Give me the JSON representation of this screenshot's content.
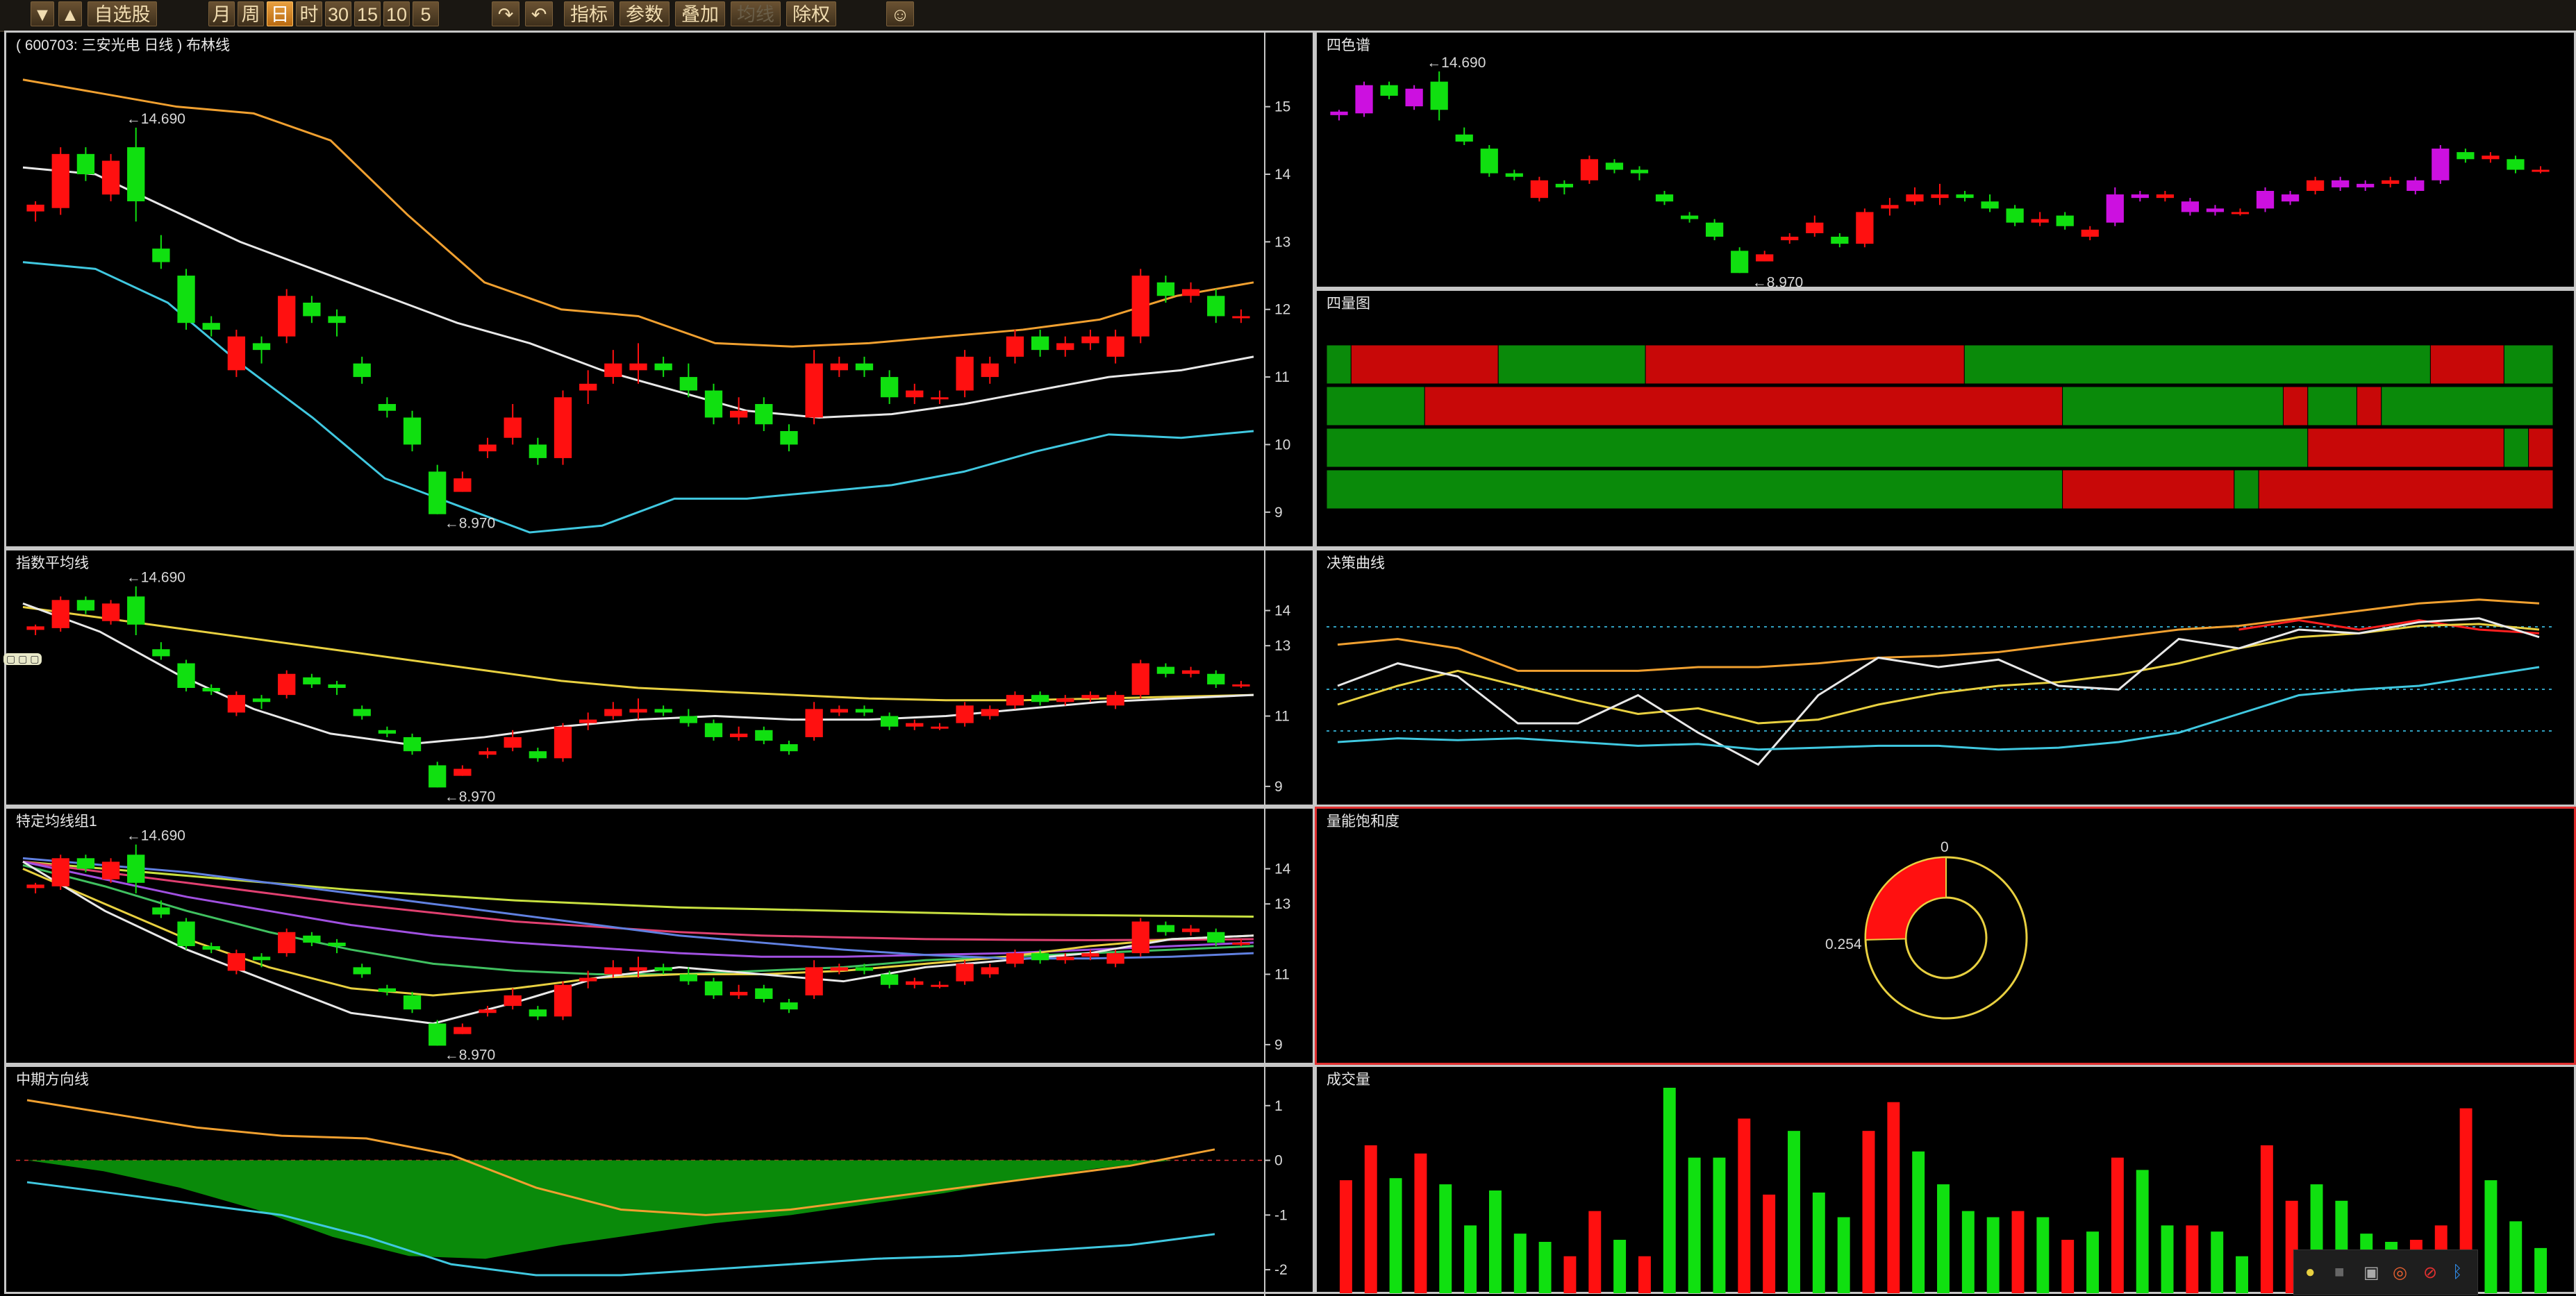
{
  "toolbar": {
    "down_arrow": "▼",
    "up_arrow": "▲",
    "watchlist": "自选股",
    "periods": [
      "月",
      "周",
      "日",
      "时",
      "30",
      "15",
      "10",
      "5"
    ],
    "active_period": "日",
    "back_icon": "back-arrow-icon",
    "undo_icon": "undo-arrow-icon",
    "indicator": "指标",
    "params": "参数",
    "overlay": "叠加",
    "ma": "均线",
    "exright": "除权",
    "face_icon": "avatar-face-icon"
  },
  "colors": {
    "up": "#ff1010",
    "down": "#10e010",
    "bg": "#000000",
    "panel_border": "#c7c7c7",
    "active_border": "#e03030",
    "purple": "#cc10e0",
    "green_fill": "#0a8a0a",
    "orange": "#f0a030",
    "white": "#e8e8e8",
    "cyan": "#40c8e0",
    "yellow": "#e8d040"
  },
  "panels": {
    "bollinger": {
      "title": "( 600703: 三安光电 日线 ) 布林线",
      "axis_labels": [
        "15",
        "14",
        "13",
        "12",
        "11",
        "10",
        "9"
      ],
      "high_label": "←14.690",
      "low_label": "←8.970"
    },
    "ema": {
      "title": "指数平均线",
      "axis_labels": [
        "14",
        "13",
        "11",
        "9"
      ],
      "high_label": "←14.690",
      "low_label": "←8.970",
      "tag": "▢ ▢ ▢"
    },
    "special_ma": {
      "title": "特定均线组1",
      "axis_labels": [
        "14",
        "13",
        "11",
        "9"
      ],
      "high_label": "←14.690",
      "low_label": "←8.970"
    },
    "mid_direction": {
      "title": "中期方向线",
      "axis_labels": [
        "1",
        "0",
        "-1",
        "-2"
      ]
    },
    "four_color": {
      "title": "四色谱",
      "high_label": "←14.690",
      "low_label": "←8.970"
    },
    "four_quadrant": {
      "title": "四量图"
    },
    "decision": {
      "title": "决策曲线"
    },
    "saturation": {
      "title": "量能饱和度",
      "top_label": "0",
      "value_label": "0.254",
      "value": 0.254
    },
    "volume": {
      "title": "成交量"
    }
  },
  "chart_data": [
    {
      "type": "candlestick",
      "name": "bollinger",
      "ylim": [
        8.7,
        15.5
      ],
      "candles": [
        [
          13.45,
          13.55,
          13.3,
          13.6
        ],
        [
          13.5,
          14.3,
          13.4,
          14.4
        ],
        [
          14.3,
          14.0,
          13.9,
          14.4
        ],
        [
          13.7,
          14.2,
          13.6,
          14.3
        ],
        [
          14.4,
          13.6,
          13.3,
          14.69
        ],
        [
          12.9,
          12.7,
          12.6,
          13.1
        ],
        [
          12.5,
          11.8,
          11.7,
          12.6
        ],
        [
          11.8,
          11.7,
          11.6,
          11.9
        ],
        [
          11.1,
          11.6,
          11.0,
          11.7
        ],
        [
          11.5,
          11.4,
          11.2,
          11.6
        ],
        [
          11.6,
          12.2,
          11.5,
          12.3
        ],
        [
          12.1,
          11.9,
          11.8,
          12.2
        ],
        [
          11.9,
          11.8,
          11.6,
          12.0
        ],
        [
          11.2,
          11.0,
          10.9,
          11.3
        ],
        [
          10.6,
          10.5,
          10.4,
          10.7
        ],
        [
          10.4,
          10.0,
          9.9,
          10.5
        ],
        [
          9.6,
          8.97,
          8.97,
          9.7
        ],
        [
          9.3,
          9.5,
          9.3,
          9.6
        ],
        [
          9.9,
          10.0,
          9.8,
          10.1
        ],
        [
          10.1,
          10.4,
          10.0,
          10.6
        ],
        [
          10.0,
          9.8,
          9.7,
          10.1
        ],
        [
          9.8,
          10.7,
          9.7,
          10.8
        ],
        [
          10.8,
          10.9,
          10.6,
          11.1
        ],
        [
          11.0,
          11.2,
          10.9,
          11.4
        ],
        [
          11.1,
          11.2,
          10.9,
          11.5
        ],
        [
          11.2,
          11.1,
          11.0,
          11.3
        ],
        [
          11.0,
          10.8,
          10.7,
          11.2
        ],
        [
          10.8,
          10.4,
          10.3,
          10.9
        ],
        [
          10.4,
          10.5,
          10.3,
          10.7
        ],
        [
          10.6,
          10.3,
          10.2,
          10.7
        ],
        [
          10.2,
          10.0,
          9.9,
          10.3
        ],
        [
          10.4,
          11.2,
          10.3,
          11.4
        ],
        [
          11.1,
          11.2,
          11.0,
          11.3
        ],
        [
          11.2,
          11.1,
          11.0,
          11.3
        ],
        [
          11.0,
          10.7,
          10.6,
          11.1
        ],
        [
          10.7,
          10.8,
          10.6,
          10.9
        ],
        [
          10.7,
          10.7,
          10.6,
          10.8
        ],
        [
          10.8,
          11.3,
          10.7,
          11.4
        ],
        [
          11.0,
          11.2,
          10.9,
          11.3
        ],
        [
          11.3,
          11.6,
          11.2,
          11.7
        ],
        [
          11.6,
          11.4,
          11.3,
          11.7
        ],
        [
          11.4,
          11.5,
          11.3,
          11.6
        ],
        [
          11.5,
          11.6,
          11.4,
          11.7
        ],
        [
          11.3,
          11.6,
          11.2,
          11.7
        ],
        [
          11.6,
          12.5,
          11.5,
          12.6
        ],
        [
          12.4,
          12.2,
          12.1,
          12.5
        ],
        [
          12.2,
          12.3,
          12.1,
          12.4
        ],
        [
          12.2,
          11.9,
          11.8,
          12.3
        ],
        [
          11.9,
          11.9,
          11.8,
          12.0
        ]
      ],
      "mid": [
        14.1,
        14.0,
        13.5,
        13.0,
        12.6,
        12.2,
        11.8,
        11.5,
        11.1,
        10.8,
        10.5,
        10.4,
        10.45,
        10.6,
        10.8,
        11.0,
        11.1,
        11.3
      ],
      "upper": [
        15.4,
        15.2,
        15.0,
        14.9,
        14.5,
        13.4,
        12.4,
        12.0,
        11.9,
        11.5,
        11.45,
        11.5,
        11.6,
        11.7,
        11.85,
        12.2,
        12.4
      ],
      "lower": [
        12.7,
        12.6,
        12.1,
        11.2,
        10.4,
        9.5,
        9.1,
        8.7,
        8.8,
        9.2,
        9.2,
        9.3,
        9.4,
        9.6,
        9.9,
        10.15,
        10.1,
        10.2
      ]
    },
    {
      "type": "bar",
      "name": "volume",
      "values": [
        0.55,
        0.72,
        0.56,
        0.68,
        0.53,
        0.33,
        0.5,
        0.29,
        0.25,
        0.18,
        0.4,
        0.26,
        0.18,
        1.0,
        0.66,
        0.66,
        0.85,
        0.48,
        0.79,
        0.49,
        0.37,
        0.79,
        0.93,
        0.69,
        0.53,
        0.4,
        0.37,
        0.4,
        0.37,
        0.26,
        0.3,
        0.66,
        0.6,
        0.33,
        0.33,
        0.3,
        0.18,
        0.72,
        0.45,
        0.53,
        0.45,
        0.29,
        0.25,
        0.26,
        0.33,
        0.9,
        0.55,
        0.35,
        0.22
      ],
      "up": [
        1,
        1,
        0,
        1,
        0,
        0,
        0,
        0,
        0,
        1,
        1,
        0,
        1,
        0,
        0,
        0,
        1,
        1,
        0,
        0,
        0,
        1,
        1,
        0,
        0,
        0,
        0,
        1,
        0,
        1,
        0,
        1,
        0,
        0,
        1,
        0,
        0,
        1,
        1,
        0,
        0,
        0,
        0,
        1,
        1,
        1,
        0,
        0,
        0
      ]
    },
    {
      "type": "bar",
      "name": "four_quadrant",
      "rows": [
        [
          [
            "g",
            1
          ],
          [
            "r",
            6
          ],
          [
            "g",
            6
          ],
          [
            "r",
            13
          ],
          [
            "g",
            19
          ],
          [
            "r",
            3
          ],
          [
            "g",
            2
          ]
        ],
        [
          [
            "g",
            4
          ],
          [
            "r",
            26
          ],
          [
            "g",
            9
          ],
          [
            "r",
            1
          ],
          [
            "g",
            2
          ],
          [
            "r",
            1
          ],
          [
            "g",
            7
          ]
        ],
        [
          [
            "g",
            40
          ],
          [
            "r",
            8
          ],
          [
            "g",
            1
          ],
          [
            "r",
            1
          ]
        ],
        [
          [
            "g",
            30
          ],
          [
            "r",
            7
          ],
          [
            "g",
            1
          ],
          [
            "r",
            12
          ]
        ]
      ]
    },
    {
      "type": "pie",
      "name": "saturation",
      "values": [
        0.254
      ]
    }
  ],
  "tray_icons": [
    "yellow-circle-icon",
    "gray-icon",
    "lock-icon",
    "eye-icon",
    "red-slash-icon",
    "bluetooth-icon"
  ]
}
